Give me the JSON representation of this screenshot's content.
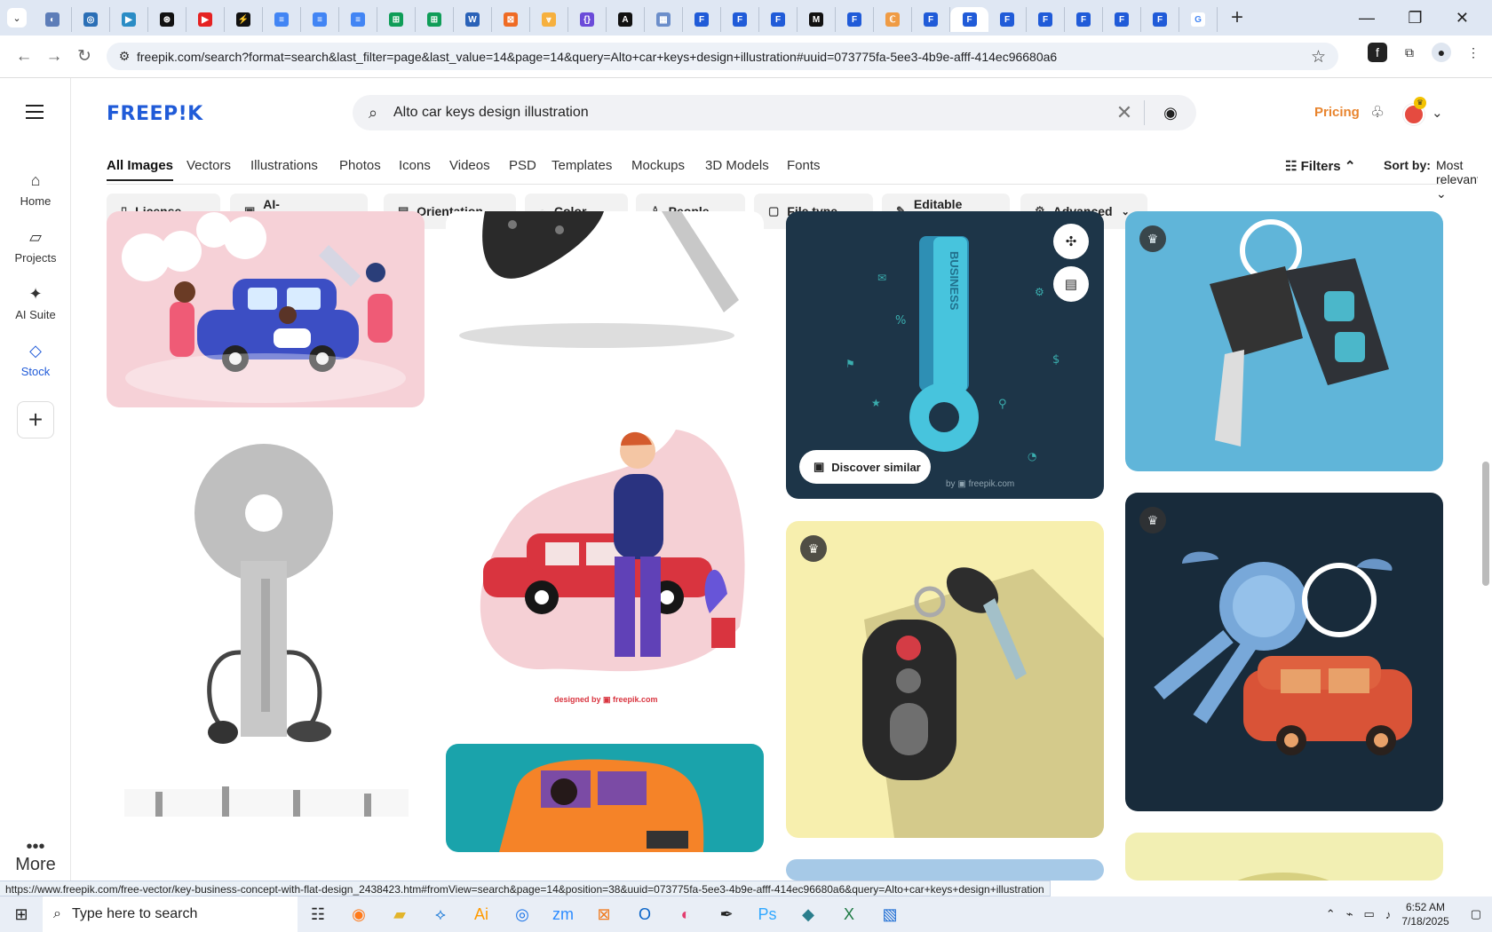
{
  "browser": {
    "url": "freepik.com/search?format=search&last_filter=page&last_value=14&page=14&query=Alto+car+keys+design+illustration#uuid=073775fa-5ee3-4b9e-afff-414ec96680a6",
    "status_url": "https://www.freepik.com/free-vector/key-business-concept-with-flat-design_2438423.htm#fromView=search&page=14&position=38&uuid=073775fa-5ee3-4b9e-afff-414ec96680a6&query=Alto+car+keys+design+illustration",
    "icons": [
      "tab-search-icon",
      "new-tab-icon",
      "minimize-icon",
      "restore-icon",
      "close-icon",
      "back-icon",
      "forward-icon",
      "reload-icon",
      "site-info-icon",
      "bookmark-star-icon",
      "extension-icon",
      "profile-icon",
      "menu-icon"
    ]
  },
  "freepik": {
    "logo": "FREEP!K",
    "search_text": "Alto car keys design illustration",
    "pricing": "Pricing",
    "rail": {
      "home": "Home",
      "projects": "Projects",
      "ai_suite": "AI Suite",
      "stock": "Stock",
      "more": "More"
    },
    "type_tabs": [
      "All Images",
      "Vectors",
      "Illustrations",
      "Photos",
      "Icons",
      "Videos",
      "PSD",
      "Templates",
      "Mockups",
      "3D Models",
      "Fonts"
    ],
    "filters": "Filters",
    "sort_label": "Sort by:",
    "sort_value": "Most relevant",
    "chips": [
      "License",
      "AI-generated",
      "Orientation",
      "Color",
      "People",
      "File type",
      "Editable online",
      "Advanced"
    ],
    "discover_similar": "Discover similar",
    "card_texts": {
      "business": "BUSINESS",
      "watermark": "designed by ▣ freepik.com",
      "small_watermark": "by ▣ freepik.com"
    }
  },
  "taskbar": {
    "search": "Type here to search",
    "time": "6:52 AM",
    "date": "7/18/2025"
  }
}
